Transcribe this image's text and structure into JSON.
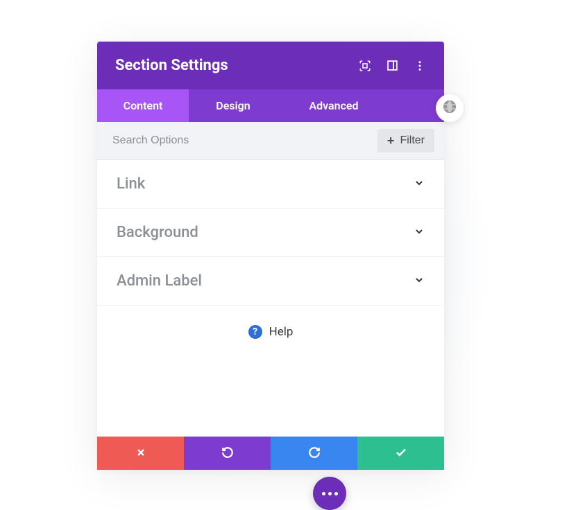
{
  "header": {
    "title": "Section Settings"
  },
  "tabs": {
    "content": "Content",
    "design": "Design",
    "advanced": "Advanced"
  },
  "search": {
    "placeholder": "Search Options",
    "filter_label": "Filter"
  },
  "accordion": {
    "items": [
      {
        "label": "Link"
      },
      {
        "label": "Background"
      },
      {
        "label": "Admin Label"
      }
    ]
  },
  "help": {
    "label": "Help"
  }
}
